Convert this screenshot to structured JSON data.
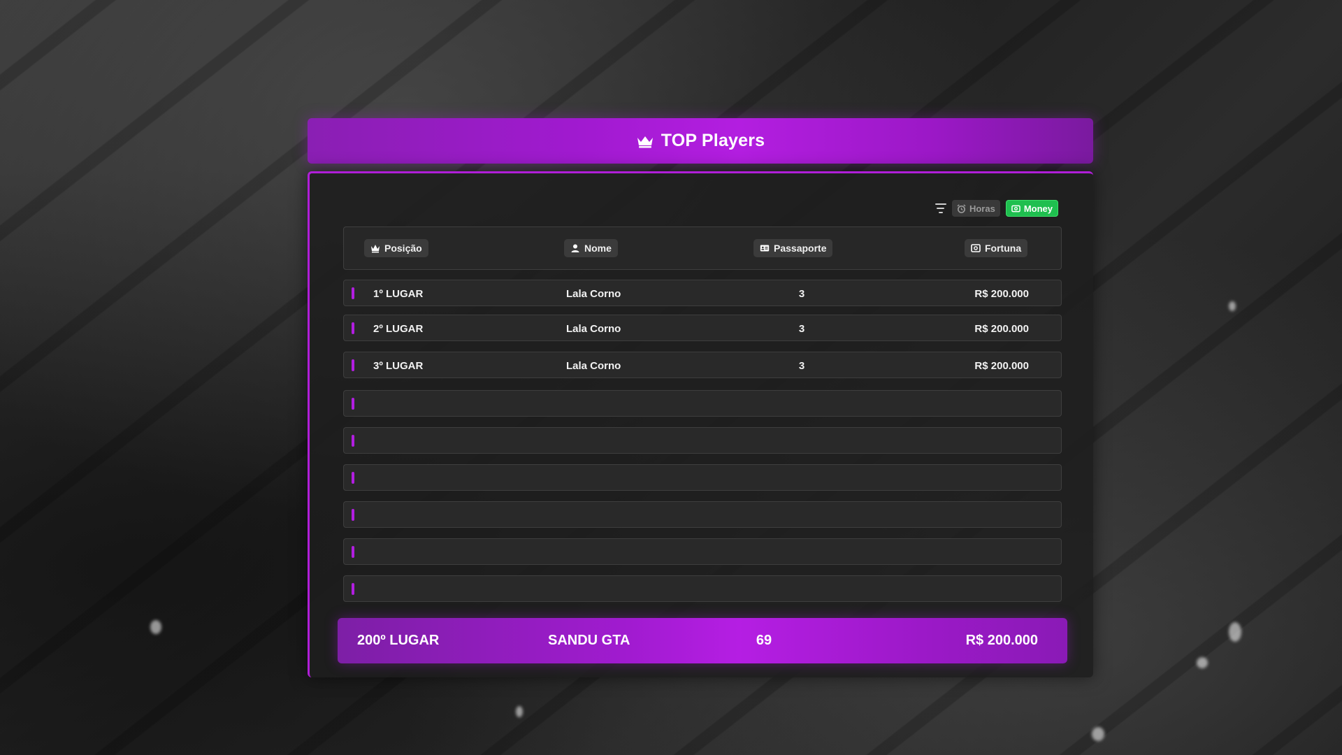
{
  "header": {
    "title": "TOP Players",
    "icon": "crown-icon"
  },
  "filters": {
    "filter_icon": "filter-icon",
    "horas_label": "Horas",
    "horas_icon": "alarm-clock-icon",
    "money_label": "Money",
    "money_icon": "cash-icon",
    "active": "Money"
  },
  "table": {
    "columns": [
      {
        "label": "Posição",
        "icon": "crown-icon"
      },
      {
        "label": "Nome",
        "icon": "user-icon"
      },
      {
        "label": "Passaporte",
        "icon": "id-card-icon"
      },
      {
        "label": "Fortuna",
        "icon": "cash-icon"
      }
    ],
    "rows": [
      {
        "position": "1º LUGAR",
        "name": "Lala Corno",
        "passport": "3",
        "fortune": "R$ 200.000"
      },
      {
        "position": "2º LUGAR",
        "name": "Lala Corno",
        "passport": "3",
        "fortune": "R$ 200.000"
      },
      {
        "position": "3º LUGAR",
        "name": "Lala Corno",
        "passport": "3",
        "fortune": "R$ 200.000"
      }
    ],
    "empty_rows": 6
  },
  "self": {
    "position": "200º LUGAR",
    "name": "SANDU GTA",
    "passport": "69",
    "fortune": "R$ 200.000"
  },
  "colors": {
    "accent": "#b01ed8",
    "money_active": "#1fbf4f"
  }
}
